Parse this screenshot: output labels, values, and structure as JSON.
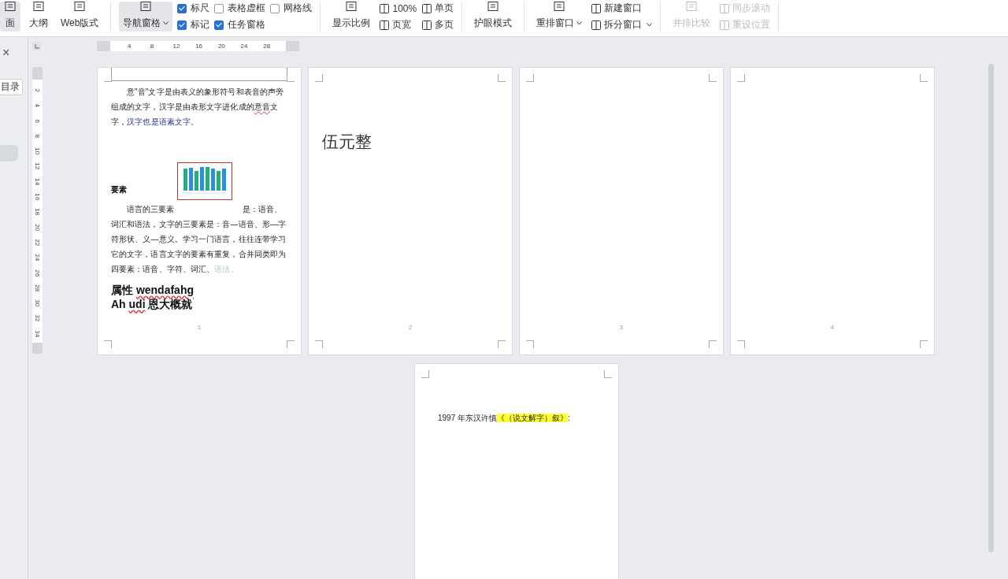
{
  "toolbar": {
    "groups": [
      {
        "columns": [
          [
            {
              "kind": "big",
              "label": "面",
              "selected": true,
              "dropdown": false,
              "disabled": false
            }
          ],
          [
            {
              "kind": "big",
              "label": "大纲",
              "selected": false,
              "dropdown": false,
              "disabled": false
            }
          ],
          [
            {
              "kind": "big",
              "label": "Web版式",
              "selected": false,
              "dropdown": false,
              "disabled": false
            }
          ]
        ]
      },
      {
        "columns": [
          [
            {
              "kind": "big",
              "label": "导航窗格",
              "selected": true,
              "dropdown": true,
              "disabled": false
            }
          ],
          [
            {
              "kind": "check",
              "label": "标尺",
              "checked": true
            },
            {
              "kind": "check",
              "label": "标记",
              "checked": true
            }
          ],
          [
            {
              "kind": "check",
              "label": "表格虚框",
              "checked": false
            },
            {
              "kind": "check",
              "label": "任务窗格",
              "checked": true
            }
          ],
          [
            {
              "kind": "check",
              "label": "网格线",
              "checked": false
            }
          ]
        ]
      },
      {
        "columns": [
          [
            {
              "kind": "big",
              "label": "显示比例",
              "selected": false,
              "dropdown": false,
              "disabled": false
            }
          ],
          [
            {
              "kind": "small",
              "label": "100%",
              "dropdown": false,
              "disabled": false
            },
            {
              "kind": "small",
              "label": "页宽",
              "dropdown": false,
              "disabled": false
            }
          ],
          [
            {
              "kind": "small",
              "label": "单页",
              "dropdown": false,
              "disabled": false
            },
            {
              "kind": "small",
              "label": "多页",
              "dropdown": false,
              "disabled": false
            }
          ]
        ]
      },
      {
        "columns": [
          [
            {
              "kind": "big",
              "label": "护眼模式",
              "selected": false,
              "dropdown": false,
              "disabled": false
            }
          ]
        ]
      },
      {
        "columns": [
          [
            {
              "kind": "big",
              "label": "重排窗口",
              "selected": false,
              "dropdown": true,
              "disabled": false
            }
          ],
          [
            {
              "kind": "small",
              "label": "新建窗口",
              "dropdown": false,
              "disabled": false
            },
            {
              "kind": "small",
              "label": "拆分窗口",
              "dropdown": true,
              "disabled": false
            }
          ]
        ]
      },
      {
        "columns": [
          [
            {
              "kind": "big",
              "label": "并排比较",
              "selected": false,
              "dropdown": false,
              "disabled": true
            }
          ],
          [
            {
              "kind": "small",
              "label": "同步滚动",
              "dropdown": false,
              "disabled": true
            },
            {
              "kind": "small",
              "label": "重设位置",
              "dropdown": false,
              "disabled": true
            }
          ]
        ]
      }
    ]
  },
  "nav_panel": {
    "close": "×",
    "toc_button": "目录"
  },
  "rulers": {
    "horizontal": [
      "4",
      "8",
      "12",
      "16",
      "20",
      "24",
      "28"
    ],
    "vertical": [
      "2",
      "4",
      "6",
      "8",
      "10",
      "12",
      "14",
      "16",
      "18",
      "20",
      "22",
      "24",
      "26",
      "28",
      "30",
      "32",
      "34"
    ]
  },
  "pages": [
    {
      "number": "1",
      "blocks": [
        {
          "kind": "header"
        },
        {
          "kind": "paragraph",
          "segments": [
            {
              "kind": "plain",
              "text": "意\"音\"文字是由表义的象形符号和表音的声旁组成的文字，汉字是由表形文字进化成的"
            },
            {
              "kind": "misspelled",
              "text": "意音"
            },
            {
              "kind": "plain",
              "text": "文字，"
            },
            {
              "kind": "link",
              "text": "汉字也是语素文字。"
            }
          ]
        },
        {
          "kind": "figure_row",
          "heading": "要素"
        },
        {
          "kind": "paragraph",
          "segments": [
            {
              "kind": "plain",
              "text": "语言的三要素"
            },
            {
              "kind": "spaced",
              "text": "是：语音、词汇和语法，文字的三要素是：音—语音、形—字符形状、义—意义。学习一门语言，往往连带学习它的文字，语言文字的要素有重复，合并同类即为四要素：语音、字符、词汇、"
            },
            {
              "kind": "faint",
              "text": "语法。"
            }
          ]
        },
        {
          "kind": "bold_line",
          "segments": [
            {
              "kind": "plain",
              "text": "属性 "
            },
            {
              "kind": "misspelled",
              "text": "wendafahg"
            }
          ]
        },
        {
          "kind": "bold_line",
          "segments": [
            {
              "kind": "plain",
              "text": "Ah "
            },
            {
              "kind": "misspelled",
              "text": "udi"
            },
            {
              "kind": "plain",
              "text": " 恩大概就"
            }
          ]
        }
      ]
    },
    {
      "number": "2",
      "blocks": [
        {
          "kind": "large_text",
          "text": "伍元整"
        }
      ]
    },
    {
      "number": "3"
    },
    {
      "number": "4"
    },
    {
      "blocks": [
        {
          "kind": "paragraph_center",
          "segments": [
            {
              "kind": "plain",
              "text": "1997 年东汉许慎"
            },
            {
              "kind": "highlight",
              "text": "《（说文解字）叙》"
            },
            {
              "kind": "plain",
              "text": ":"
            }
          ]
        }
      ]
    }
  ]
}
